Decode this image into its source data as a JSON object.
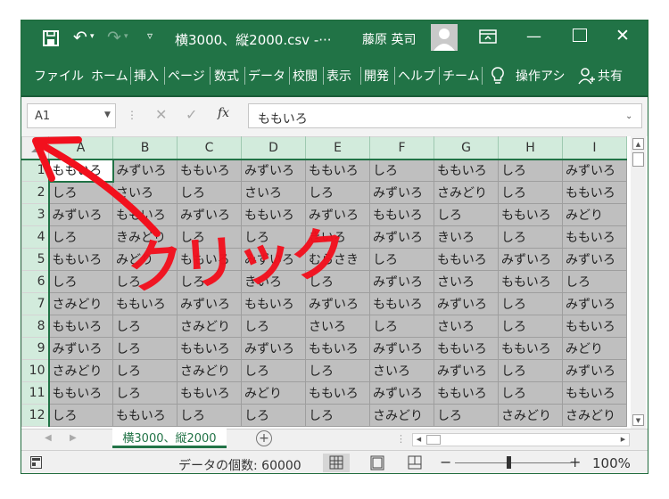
{
  "title_bar": {
    "document_title": "横3000、縦2000.csv  -···",
    "user_name": "藤原 英司"
  },
  "menu": {
    "items": [
      "ファイル",
      "ホーム",
      "挿入",
      "ページ",
      "数式",
      "データ",
      "校閲",
      "表示",
      "開発",
      "ヘルプ",
      "チーム",
      "操作アシ",
      "共有"
    ]
  },
  "formula_bar": {
    "name_box": "A1",
    "fx_label": "fx",
    "formula": "ももいろ"
  },
  "sheet": {
    "columns": [
      "A",
      "B",
      "C",
      "D",
      "E",
      "F",
      "G",
      "H",
      "I"
    ],
    "rows": [
      {
        "num": "1",
        "cells": [
          "ももいろ",
          "みずいろ",
          "ももいろ",
          "みずいろ",
          "ももいろ",
          "しろ",
          "ももいろ",
          "しろ",
          "みずいろ"
        ]
      },
      {
        "num": "2",
        "cells": [
          "しろ",
          "さいろ",
          "しろ",
          "さいろ",
          "しろ",
          "みずいろ",
          "さみどり",
          "しろ",
          "ももいろ"
        ]
      },
      {
        "num": "3",
        "cells": [
          "みずいろ",
          "ももいろ",
          "みずいろ",
          "ももいろ",
          "みずいろ",
          "ももいろ",
          "しろ",
          "ももいろ",
          "みどり"
        ]
      },
      {
        "num": "4",
        "cells": [
          "しろ",
          "きみどり",
          "しろ",
          "しろ",
          "きいろ",
          "みずいろ",
          "きいろ",
          "しろ",
          "ももいろ"
        ]
      },
      {
        "num": "5",
        "cells": [
          "ももいろ",
          "みどり",
          "ももいろ",
          "みずいろ",
          "むらさき",
          "しろ",
          "ももいろ",
          "みずいろ",
          "みずいろ"
        ]
      },
      {
        "num": "6",
        "cells": [
          "しろ",
          "しろ",
          "しろ",
          "きいろ",
          "しろ",
          "みずいろ",
          "さいろ",
          "ももいろ",
          "しろ"
        ]
      },
      {
        "num": "7",
        "cells": [
          "さみどり",
          "ももいろ",
          "みずいろ",
          "ももいろ",
          "みずいろ",
          "ももいろ",
          "みずいろ",
          "しろ",
          "みずいろ"
        ]
      },
      {
        "num": "8",
        "cells": [
          "ももいろ",
          "しろ",
          "さみどり",
          "しろ",
          "さいろ",
          "しろ",
          "さいろ",
          "しろ",
          "ももいろ"
        ]
      },
      {
        "num": "9",
        "cells": [
          "みずいろ",
          "しろ",
          "ももいろ",
          "みずいろ",
          "ももいろ",
          "みずいろ",
          "ももいろ",
          "ももいろ",
          "みどり"
        ]
      },
      {
        "num": "10",
        "cells": [
          "さみどり",
          "しろ",
          "さみどり",
          "しろ",
          "しろ",
          "さいろ",
          "みずいろ",
          "しろ",
          "みずいろ"
        ]
      },
      {
        "num": "11",
        "cells": [
          "ももいろ",
          "しろ",
          "ももいろ",
          "みどり",
          "ももいろ",
          "みずいろ",
          "ももいろ",
          "しろ",
          "ももいろ"
        ]
      },
      {
        "num": "12",
        "cells": [
          "しろ",
          "ももいろ",
          "しろ",
          "しろ",
          "しろ",
          "さみどり",
          "しろ",
          "さみどり",
          "さみどり"
        ]
      }
    ]
  },
  "sheet_tabs": {
    "active": "横3000、縦2000"
  },
  "status_bar": {
    "count": "データの個数: 60000",
    "zoom": "100%"
  },
  "annotation": {
    "text": "クリック",
    "color": "#f2101d"
  },
  "colors": {
    "brand": "#217346",
    "selection_gray": "#bfbfbf",
    "header_green": "#d2ebdc"
  }
}
